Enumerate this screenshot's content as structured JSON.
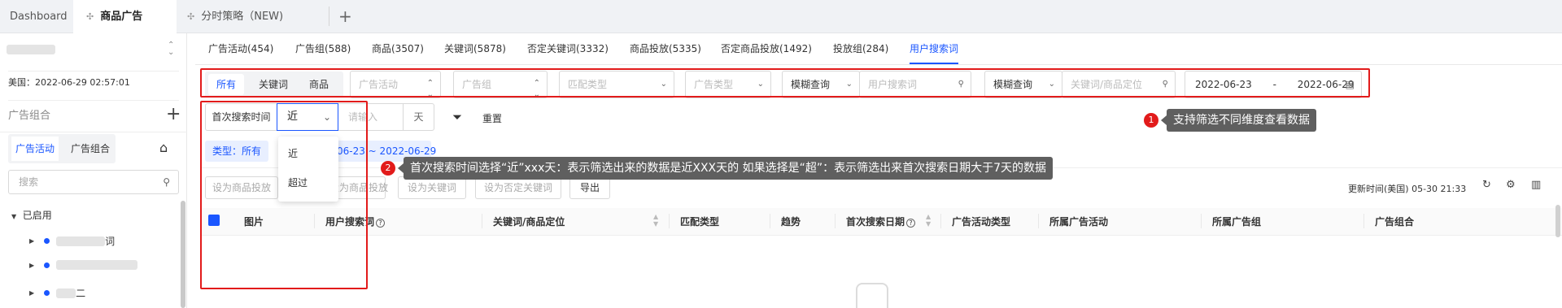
{
  "top_tabs": [
    {
      "label": "Dashboard"
    },
    {
      "label": "商品广告"
    },
    {
      "label": "分时策略（NEW)"
    }
  ],
  "add_tab": "+",
  "sidebar": {
    "region_time": "美国：2022-06-29 02:57:01",
    "section_title": "广告组合",
    "add_symbol": "+",
    "tabs": [
      "广告活动",
      "广告组合"
    ],
    "search_placeholder": "搜索",
    "tree_group": "已启用",
    "tree_items": [
      "词",
      "",
      "二"
    ]
  },
  "main_tabs": [
    "广告活动(454)",
    "广告组(588)",
    "商品(3507)",
    "关键词(5878)",
    "否定关键词(3332)",
    "商品投放(5335)",
    "否定商品投放(1492)",
    "投放组(284)",
    "用户搜索词"
  ],
  "filters": {
    "segments": [
      "所有",
      "关键词",
      "商品"
    ],
    "campaign_placeholder": "广告活动",
    "adgroup_placeholder": "广告组",
    "match_type_placeholder": "匹配类型",
    "ad_type_placeholder": "广告类型",
    "fuzzy_query_1": "模糊查询",
    "search_term_placeholder": "用户搜索词",
    "fuzzy_query_2": "模糊查询",
    "keyword_placeholder": "关键词/商品定位",
    "date_start": "2022-06-23",
    "date_sep": "-",
    "date_end": "2022-06-29"
  },
  "first_search": {
    "label": "首次搜索时间",
    "selected": "近",
    "input_placeholder": "请输入",
    "unit": "天",
    "reset": "重置",
    "options": [
      "近",
      "超过"
    ]
  },
  "chips": {
    "type_chip": "类型：所有",
    "date_chip": "06-23 ~ 2022-06-29"
  },
  "actions": [
    "设为商品投放",
    "设为商品投放",
    "设为关键词",
    "设为否定关键词",
    "导出"
  ],
  "update_time": "更新时间(美国) 05-30 21:33",
  "table_headers": [
    "图片",
    "用户搜索词",
    "关键词/商品定位",
    "匹配类型",
    "趋势",
    "首次搜索日期",
    "广告活动类型",
    "所属广告活动",
    "所属广告组",
    "广告组合"
  ],
  "annotations": [
    {
      "num": "1",
      "text": "支持筛选不同维度查看数据"
    },
    {
      "num": "2",
      "text": "首次搜索时间选择“近”xxx天：表示筛选出来的数据是近XXX天的  如果选择是“超”：表示筛选出来首次搜索日期大于7天的数据"
    }
  ],
  "colors": {
    "accent": "#1a56ff",
    "annotation_red": "#e21b1b",
    "tooltip_bg": "#5f5f5f"
  }
}
